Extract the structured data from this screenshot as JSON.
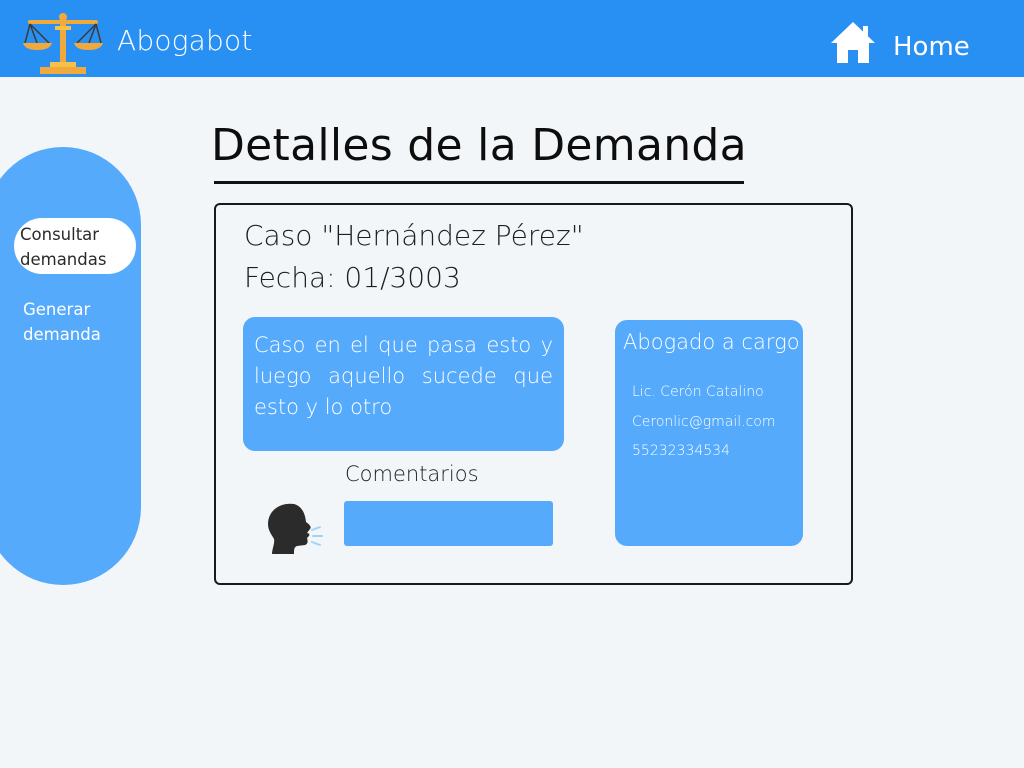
{
  "header": {
    "app_title": "Abogabot",
    "logo_icon": "scales-of-justice-icon",
    "home_icon": "house-icon",
    "home_label": "Home",
    "bg_color": "#2990f3"
  },
  "sidebar": {
    "items": [
      {
        "label": "Consultar demandas",
        "active": true
      },
      {
        "label": "Generar demanda",
        "active": false
      }
    ],
    "bg_color": "#56aafc"
  },
  "main": {
    "page_title": "Detalles de la Demanda",
    "case_title": "Caso \"Hernández Pérez\"",
    "case_date": "Fecha: 01/3003",
    "description": "Caso en el que pasa esto y luego aquello sucede que esto y lo otro",
    "comments": {
      "label": "Comentarios",
      "icon": "speaking-head-icon",
      "value": ""
    },
    "lawyer": {
      "heading": "Abogado a cargo",
      "name": "Lic. Cerón Catalino",
      "email": "Ceronlic@gmail.com",
      "phone": "55232334534"
    },
    "accent_color": "#56aafc"
  }
}
